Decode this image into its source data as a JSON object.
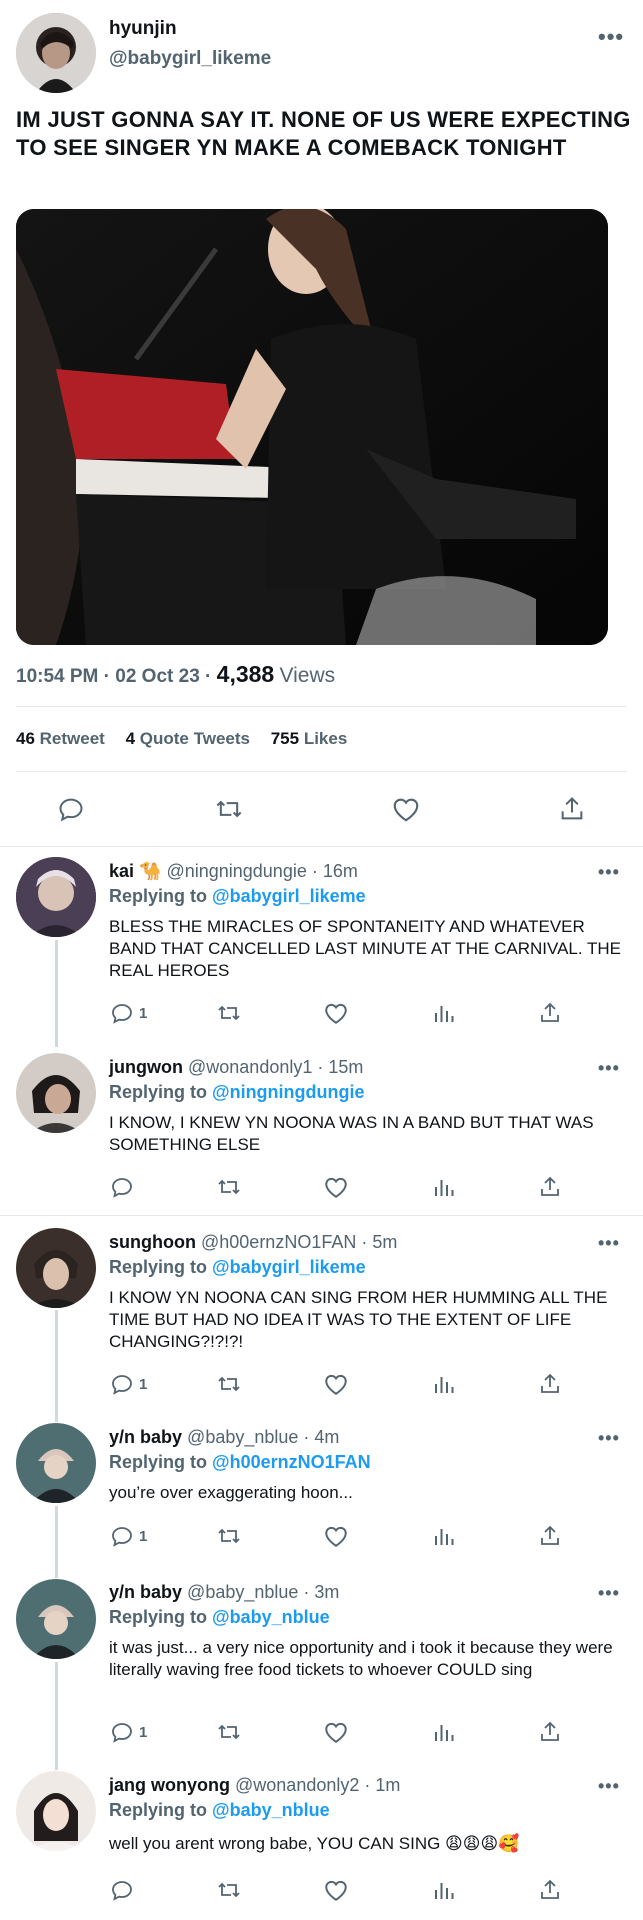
{
  "main_tweet": {
    "name": "hyunjin",
    "handle": "@babygirl_likeme",
    "text": "IM JUST GONNA SAY IT. NONE OF US WERE EXPECTING TO SEE SINGER YN MAKE A COMEBACK TONIGHT",
    "time": "10:54 PM · 02 Oct 23 ·",
    "views_count": "4,388",
    "views_label": "Views",
    "retweets": {
      "count": "46",
      "label": "Retweet"
    },
    "quotes": {
      "count": "4",
      "label": "Quote Tweets"
    },
    "likes": {
      "count": "755",
      "label": "Likes"
    },
    "more_label": "•••"
  },
  "replies": [
    {
      "name": "kai 🐪",
      "meta": "@ningningdungie · 16m",
      "replying_prefix": "Replying to",
      "replying_to": "@babygirl_likeme",
      "text": "BLESS THE MIRACLES OF SPONTANEITY AND WHATEVER BAND THAT CANCELLED LAST MINUTE AT THE CARNIVAL. THE REAL HEROES",
      "reply_count": "1"
    },
    {
      "name": "jungwon",
      "meta": "@wonandonly1 · 15m",
      "replying_prefix": "Replying to",
      "replying_to": "@ningningdungie",
      "text": "I KNOW, I KNEW YN NOONA WAS IN A BAND BUT THAT WAS SOMETHING ELSE",
      "reply_count": ""
    },
    {
      "name": "sunghoon",
      "meta": "@h00ernzNO1FAN · 5m",
      "replying_prefix": "Replying to",
      "replying_to": "@babygirl_likeme",
      "text": "I KNOW YN NOONA CAN SING FROM HER HUMMING ALL THE TIME BUT HAD NO IDEA IT WAS TO THE EXTENT OF LIFE CHANGING?!?!?!",
      "reply_count": "1"
    },
    {
      "name": "y/n baby",
      "meta": "@baby_nblue · 4m",
      "replying_prefix": "Replying to",
      "replying_to": "@h00ernzNO1FAN",
      "text": "you’re over exaggerating hoon...",
      "reply_count": "1"
    },
    {
      "name": "y/n baby",
      "meta": "@baby_nblue · 3m",
      "replying_prefix": "Replying to",
      "replying_to": "@baby_nblue",
      "text": "it was just... a very nice opportunity and i took it because they were literally waving free food tickets to whoever COULD sing",
      "reply_count": "1"
    },
    {
      "name": "jang wonyong",
      "meta": "@wonandonly2 · 1m",
      "replying_prefix": "Replying to",
      "replying_to": "@baby_nblue",
      "text": "well you arent wrong babe, YOU CAN SING 😩😩😩🥰",
      "reply_count": ""
    }
  ],
  "icons": [
    "reply-icon",
    "retweet-icon",
    "like-icon",
    "views-icon",
    "share-icon",
    "more-icon"
  ],
  "colors": {
    "link": "#1d9bf0",
    "secondary": "#536471",
    "text": "#0f1419"
  }
}
